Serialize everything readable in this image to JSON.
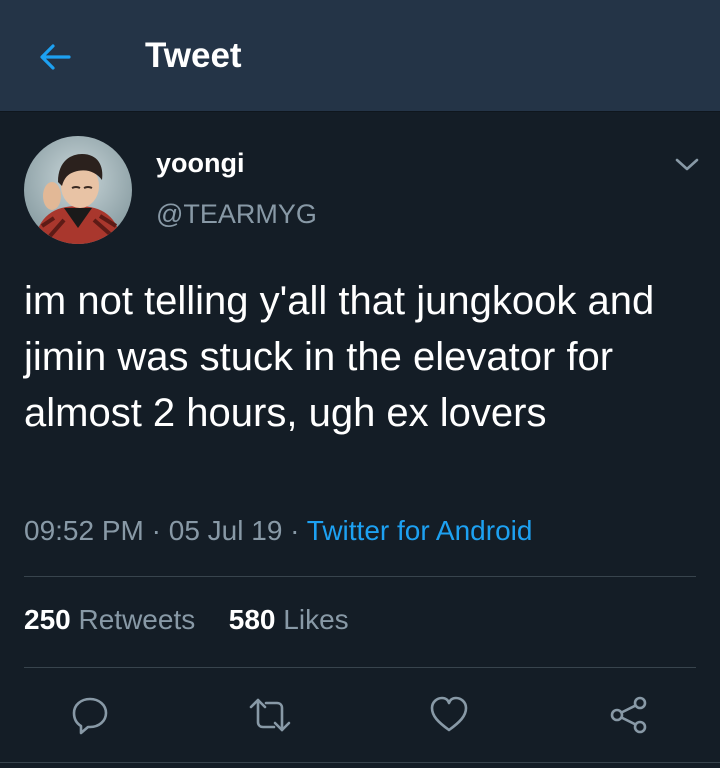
{
  "appbar": {
    "title": "Tweet",
    "back_icon": "back-arrow-icon",
    "accent": "#1da1f2"
  },
  "tweet": {
    "display_name": "yoongi",
    "handle": "@TEARMYG",
    "text": "im not telling y'all that jungkook and jimin was stuck in the elevator for almost 2 hours, ugh ex lovers",
    "time": "09:52 PM",
    "date": "05 Jul 19",
    "separator": " · ",
    "source": "Twitter for Android",
    "retweets_count": "250",
    "retweets_label": "Retweets",
    "likes_count": "580",
    "likes_label": "Likes"
  },
  "actions": [
    "reply-icon",
    "retweet-icon",
    "like-icon",
    "share-icon"
  ],
  "colors": {
    "background": "#141d26",
    "header": "#243447",
    "muted": "#8899a6",
    "link": "#1da1f2"
  }
}
